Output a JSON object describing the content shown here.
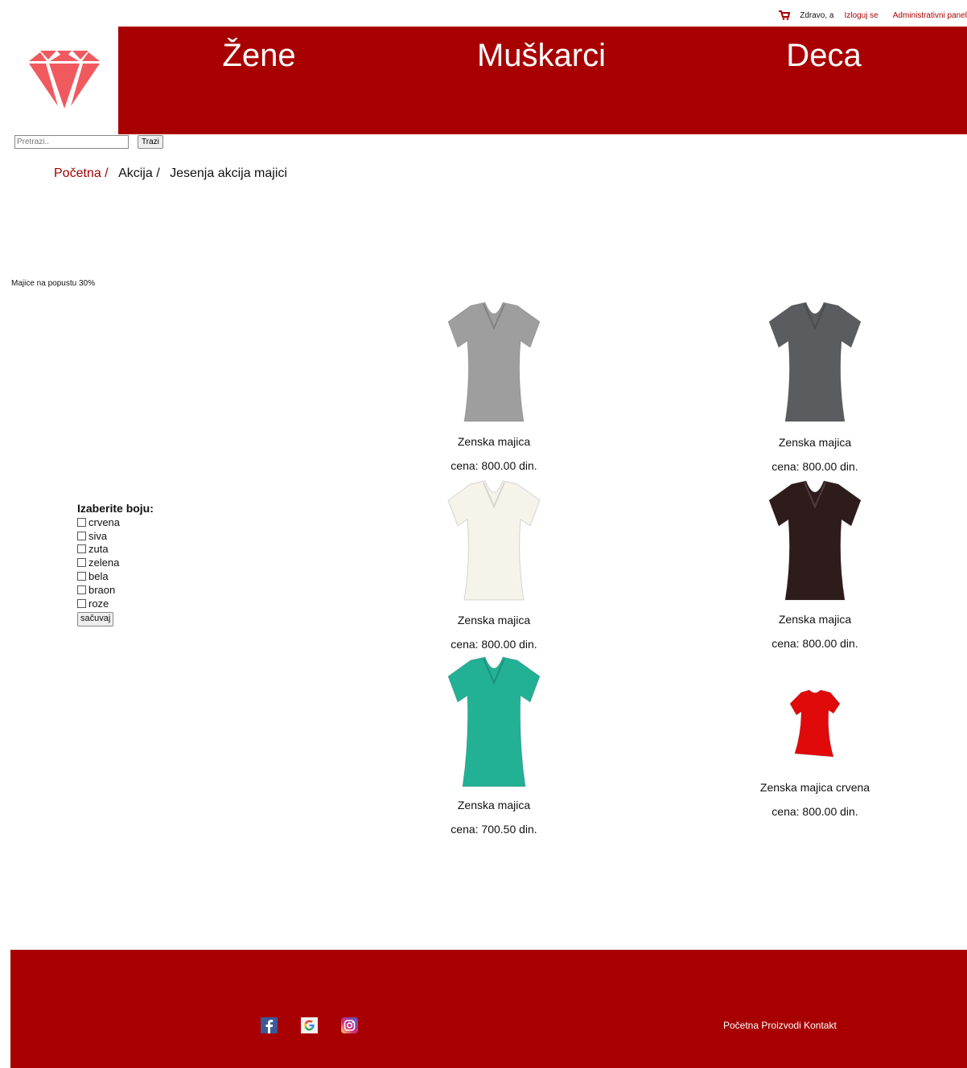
{
  "topbar": {
    "greeting": "Zdravo, a",
    "logout": "Izloguj se",
    "admin": "Administrativni panel"
  },
  "nav": {
    "items": [
      "Žene",
      "Muškarci",
      "Deca"
    ]
  },
  "search": {
    "placeholder": "Pretrazi..",
    "button": "Trazi"
  },
  "breadcrumb": {
    "home": "Početna /",
    "level1": "Akcija /",
    "level2": "Jesenja akcija majici"
  },
  "promo_text": "Majice na popustu 30%",
  "filter": {
    "title": "Izaberite boju:",
    "options": [
      "crvena",
      "siva",
      "zuta",
      "zelena",
      "bela",
      "braon",
      "roze"
    ],
    "save": "sačuvaj"
  },
  "products": [
    {
      "name": "Zenska majica",
      "price": "cena: 800.00 din.",
      "color": "#9e9e9e"
    },
    {
      "name": "Zenska majica",
      "price": "cena: 800.00 din.",
      "color": "#5b5c60"
    },
    {
      "name": "Zenska majica",
      "price": "cena: 800.00 din.",
      "color": "#f6f3ea"
    },
    {
      "name": "Zenska majica",
      "price": "cena: 800.00 din.",
      "color": "#2e1c1c"
    },
    {
      "name": "Zenska majica",
      "price": "cena: 700.50 din.",
      "color": "#23b196"
    },
    {
      "name": "Zenska majica crvena",
      "price": "cena: 800.00 din.",
      "color": "#e10a0a"
    }
  ],
  "footer": {
    "social_icons": [
      "facebook-icon",
      "google-icon",
      "instagram-icon"
    ],
    "links": [
      "Početna",
      "Proizvodi",
      "Kontakt"
    ]
  },
  "colors": {
    "brand": "#a80000",
    "logo": "#f05a5f"
  }
}
